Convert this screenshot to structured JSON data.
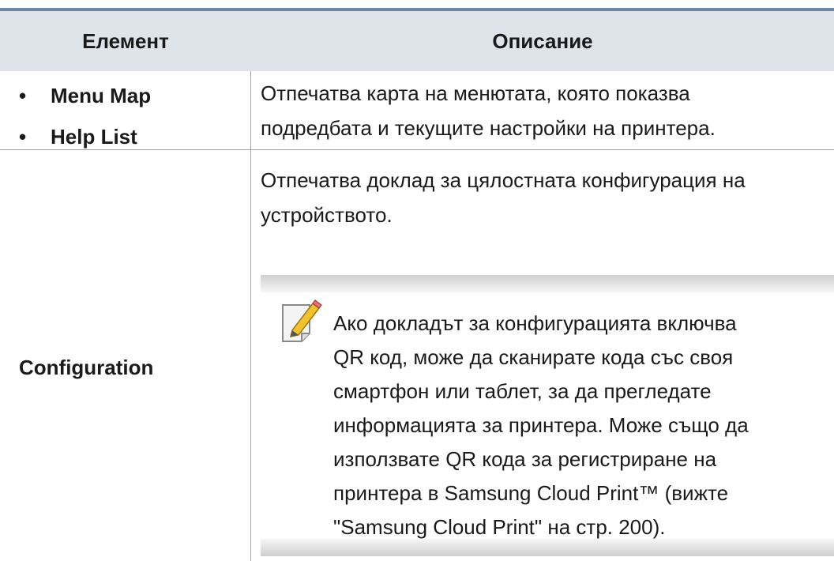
{
  "header": {
    "col1": "Елемент",
    "col2": "Описание"
  },
  "rows": [
    {
      "items": [
        "Menu Map",
        "Help List"
      ],
      "bullet": "•",
      "description_lines": [
        "Отпечатва карта на менютата, която показва",
        "подредбата и текущите настройки на принтера."
      ]
    },
    {
      "label": "Configuration",
      "description_lines": [
        "Отпечатва доклад за цялостната конфигурация на",
        "устройството."
      ],
      "note": {
        "icon": "note-pencil-icon",
        "lines": [
          "Ако докладът за конфигурацията включва",
          "QR код, може да сканирате кода със своя",
          "смартфон или таблет, за да прегледате",
          "информацията за принтера. Може също да",
          "използвате QR кода за регистриране на",
          "принтера в Samsung Cloud Print™ (вижте",
          "\"Samsung Cloud Print\" на стр. 200)."
        ]
      }
    }
  ],
  "colors": {
    "header_bg": "#dfe4ea",
    "top_rule": "#6c88a6",
    "grid": "#9aa6b2"
  }
}
